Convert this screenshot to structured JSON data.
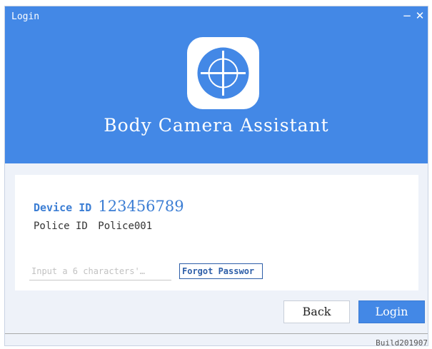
{
  "window": {
    "title": "Login",
    "minimize_glyph": "−",
    "close_glyph": "✕"
  },
  "app": {
    "logo_icon": "crosshair-target-icon",
    "name": "Body Camera Assistant"
  },
  "device": {
    "label": "Device ID",
    "value": "123456789"
  },
  "police": {
    "label": "Police ID",
    "value": "Police001"
  },
  "password": {
    "placeholder": "Input a 6 characters'…",
    "value": ""
  },
  "forgot_password": {
    "label": "Forgot Passwor"
  },
  "buttons": {
    "back": "Back",
    "login": "Login"
  },
  "build": "Build201907",
  "colors": {
    "header_blue": "#4388e6",
    "link_blue": "#3c7ed4",
    "background": "#eef2f9"
  }
}
